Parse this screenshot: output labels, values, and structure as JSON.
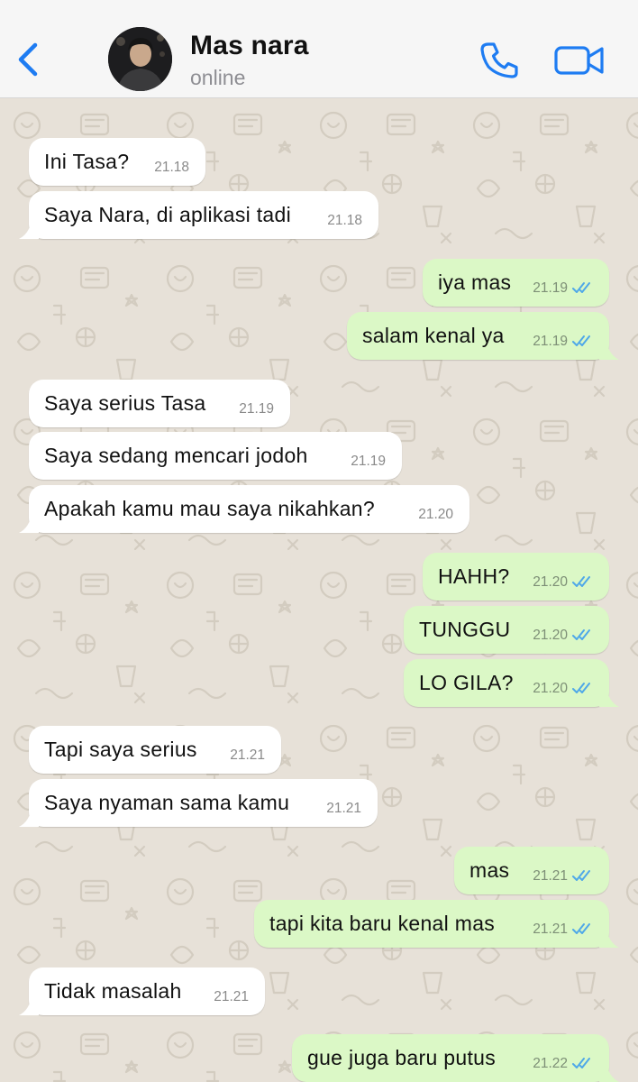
{
  "header": {
    "contact_name": "Mas nara",
    "status": "online"
  },
  "colors": {
    "accent": "#1e7cf2",
    "incoming_bubble": "#ffffff",
    "outgoing_bubble": "#dbf8c6",
    "read_ticks": "#4fa8e8",
    "wallpaper": "#e7e1d8"
  },
  "icons": {
    "back": "chevron-left-icon",
    "call": "phone-icon",
    "video": "video-camera-icon",
    "read": "double-check-icon"
  },
  "messages": [
    {
      "direction": "in",
      "text": "Ini Tasa?",
      "time": "21.18"
    },
    {
      "direction": "in",
      "text": "Saya Nara, di aplikasi tadi",
      "time": "21.18"
    },
    {
      "direction": "out",
      "text": "iya mas",
      "time": "21.19",
      "status": "read"
    },
    {
      "direction": "out",
      "text": "salam kenal ya",
      "time": "21.19",
      "status": "read"
    },
    {
      "direction": "in",
      "text": "Saya serius Tasa",
      "time": "21.19"
    },
    {
      "direction": "in",
      "text": "Saya sedang mencari jodoh",
      "time": "21.19"
    },
    {
      "direction": "in",
      "text": "Apakah kamu mau saya nikahkan?",
      "time": "21.20"
    },
    {
      "direction": "out",
      "text": "HAHH?",
      "time": "21.20",
      "status": "read"
    },
    {
      "direction": "out",
      "text": "TUNGGU",
      "time": "21.20",
      "status": "read"
    },
    {
      "direction": "out",
      "text": "LO GILA?",
      "time": "21.20",
      "status": "read"
    },
    {
      "direction": "in",
      "text": "Tapi saya serius",
      "time": "21.21"
    },
    {
      "direction": "in",
      "text": "Saya nyaman sama kamu",
      "time": "21.21"
    },
    {
      "direction": "out",
      "text": "mas",
      "time": "21.21",
      "status": "read"
    },
    {
      "direction": "out",
      "text": "tapi kita baru kenal mas",
      "time": "21.21",
      "status": "read"
    },
    {
      "direction": "in",
      "text": "Tidak masalah",
      "time": "21.21"
    },
    {
      "direction": "out",
      "text": "gue juga baru putus",
      "time": "21.22",
      "status": "read"
    }
  ]
}
